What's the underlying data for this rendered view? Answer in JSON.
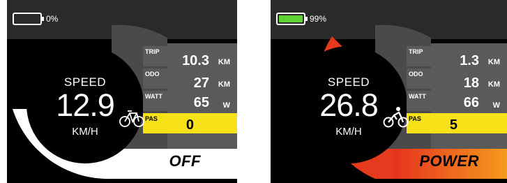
{
  "screens": [
    {
      "battery_pct": "0%",
      "battery_level": 0,
      "speed_label": "SPEED",
      "speed": "12.9",
      "speed_unit": "KM/H",
      "speed_gauge_fraction": 0.36,
      "trip_label": "TRIP",
      "trip_value": "10.3",
      "trip_unit": "KM",
      "odo_label": "ODO",
      "odo_value": "27",
      "odo_unit": "KM",
      "watt_label": "WATT",
      "watt_value": "65",
      "watt_unit": "W",
      "pas_label": "PAS",
      "pas_value": "0",
      "mode": "OFF",
      "icon": "bicycle-icon"
    },
    {
      "battery_pct": "99%",
      "battery_level": 0.99,
      "speed_label": "SPEED",
      "speed": "26.8",
      "speed_unit": "KM/H",
      "speed_gauge_fraction": 0.7,
      "trip_label": "TRIP",
      "trip_value": "1.3",
      "trip_unit": "KM",
      "odo_label": "ODO",
      "odo_value": "18",
      "odo_unit": "KM",
      "watt_label": "WATT",
      "watt_value": "66",
      "watt_unit": "W",
      "pas_label": "PAS",
      "pas_value": "5",
      "mode": "POWER",
      "icon": "cyclist-icon"
    }
  ],
  "colors": {
    "topbar": "#2a2a2a",
    "gauge_track": "#4a4a4a",
    "row_panel": "#5a5a5a",
    "pas_yellow": "#f7e21a",
    "battery_green": "#5fd336",
    "gauge_off": "#ffffff",
    "gauge_power": "#e63a1f",
    "mode_off_bg": "#ffffff",
    "mode_power_start": "#e6331e",
    "mode_power_end": "#f59a1d"
  }
}
